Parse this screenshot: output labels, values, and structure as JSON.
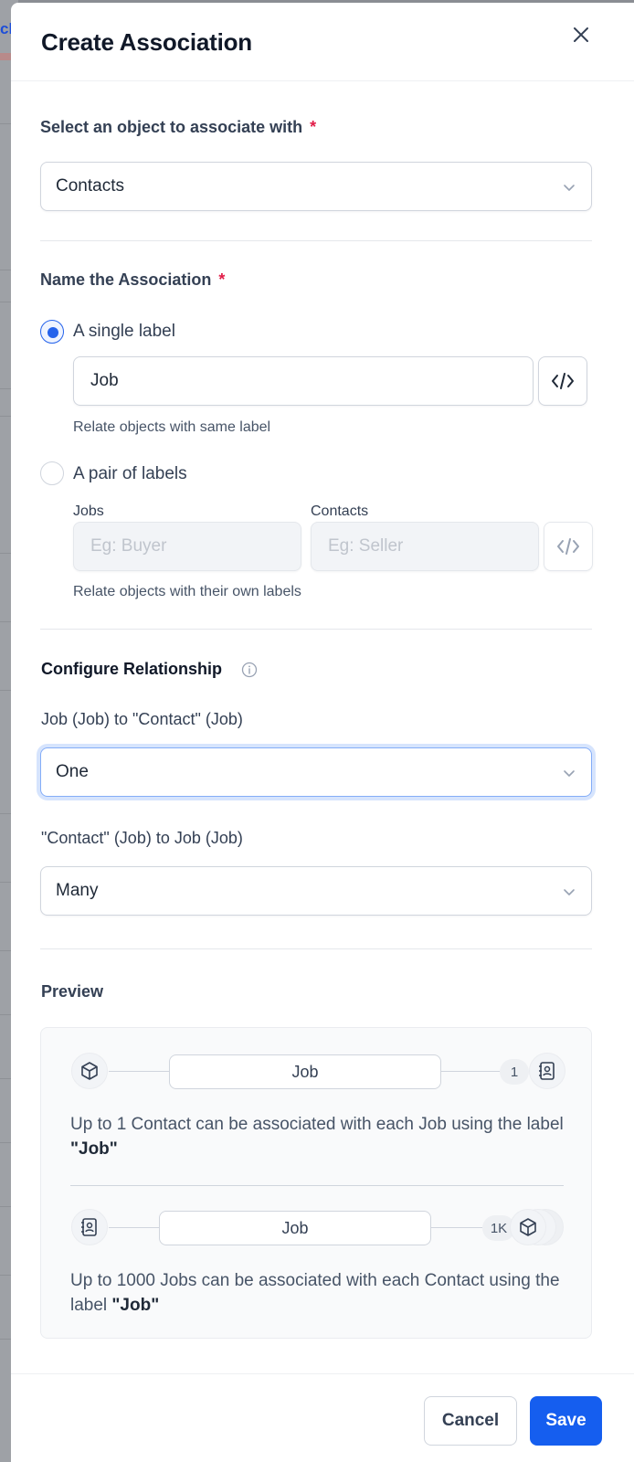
{
  "background": {
    "partial_text": "ch"
  },
  "modal": {
    "title": "Create Association"
  },
  "object_section": {
    "label": "Select an object to associate with",
    "required_mark": "*",
    "selected_value": "Contacts"
  },
  "name_section": {
    "label": "Name the Association",
    "required_mark": "*",
    "single_label": {
      "option_label": "A single label",
      "checked": true,
      "input_value": "Job",
      "hint": "Relate objects with same label"
    },
    "pair_labels": {
      "option_label": "A pair of labels",
      "checked": false,
      "left_label": "Jobs",
      "left_placeholder": "Eg: Buyer",
      "right_label": "Contacts",
      "right_placeholder": "Eg: Seller",
      "hint": "Relate objects with their own labels"
    }
  },
  "relationship": {
    "title": "Configure Relationship",
    "first": {
      "label": "Job (Job) to \"Contact\" (Job)",
      "value": "One"
    },
    "second": {
      "label": "\"Contact\" (Job) to Job (Job)",
      "value": "Many"
    }
  },
  "preview": {
    "title": "Preview",
    "row1": {
      "pill": "Job",
      "count": "1",
      "text_prefix": "Up to 1 Contact can be associated with each Job using the label ",
      "text_bold": "\"Job\""
    },
    "row2": {
      "pill": "Job",
      "count": "1K",
      "text_prefix": "Up to 1000 Jobs can be associated with each Contact using the label ",
      "text_bold": "\"Job\""
    }
  },
  "footer": {
    "cancel_label": "Cancel",
    "save_label": "Save"
  },
  "colors": {
    "primary": "#155eef",
    "required": "#e11d48",
    "focus_ring": "#d6e4fd"
  },
  "icons": {
    "close": "close-icon",
    "chevron": "chevron-down-icon",
    "code": "code-icon",
    "info": "info-icon",
    "object": "cube-icon",
    "contact": "contact-book-icon"
  }
}
